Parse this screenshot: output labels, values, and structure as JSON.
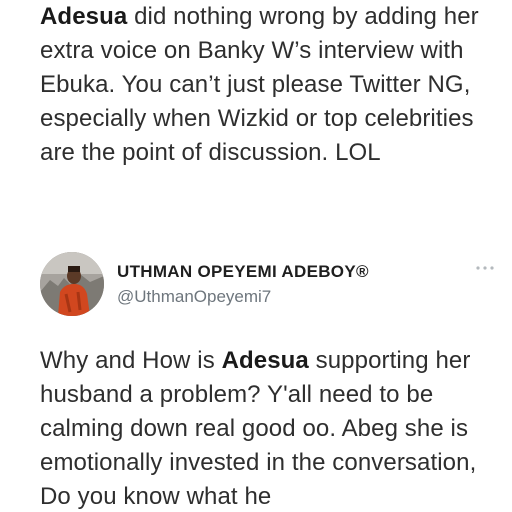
{
  "tweet_1": {
    "author_mention": "Adesua",
    "text": " did nothing wrong by adding her extra voice on Banky W’s interview with Ebuka. You can’t just please Twitter NG, especially when Wizkid or top celebrities are the point of discussion. LOL"
  },
  "tweet_2": {
    "author": {
      "name": "UTHMAN OPEYEMI ADEBOY®",
      "handle": "@UthmanOpeyemi7"
    },
    "more_icon": "more-horizontal-icon",
    "text_before": "Why and How is ",
    "mention": "Adesua",
    "text_after": " supporting her husband a problem? Y'all need to be calming down real good oo. Abeg she is emotionally invested in the conversation, Do you know what he"
  }
}
